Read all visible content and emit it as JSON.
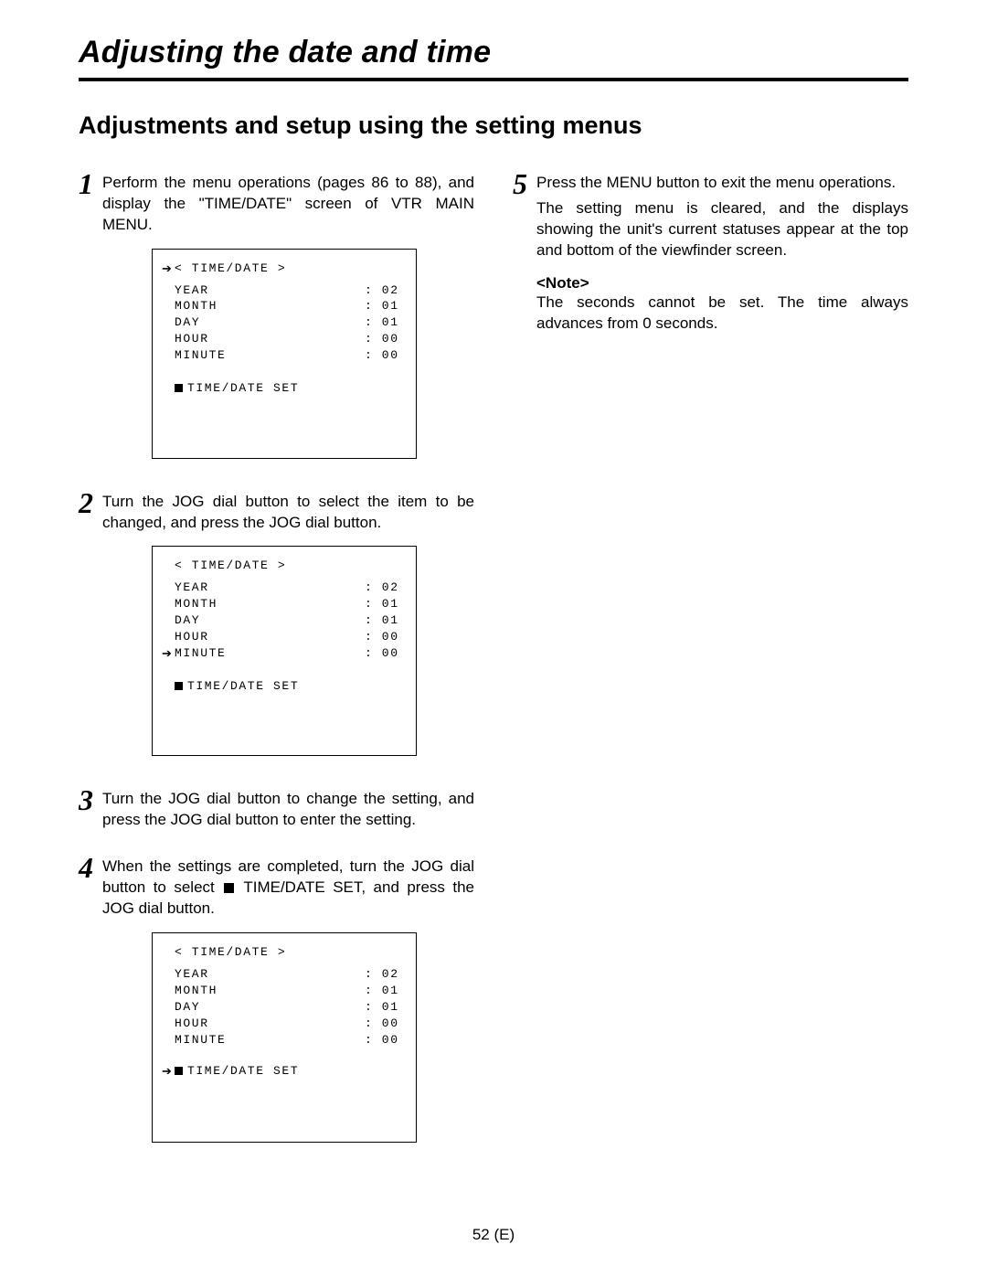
{
  "page": {
    "title": "Adjusting the date and time",
    "subtitle": "Adjustments and setup using the setting menus",
    "footer": "52 (E)"
  },
  "steps": {
    "s1": {
      "num": "1",
      "text": "Perform the menu operations (pages 86 to 88), and display the \"TIME/DATE\" screen of VTR MAIN MENU."
    },
    "s2": {
      "num": "2",
      "text": "Turn the JOG dial button to select the item to be changed, and press the JOG dial button."
    },
    "s3": {
      "num": "3",
      "text": "Turn the JOG dial button to change the setting, and press the JOG dial button to enter the setting."
    },
    "s4": {
      "num": "4",
      "text_a": "When the settings are completed, turn the JOG dial button to select ",
      "text_b": " TIME/DATE SET, and press the JOG dial button."
    },
    "s5": {
      "num": "5",
      "text_a": "Press the MENU button to exit the menu operations.",
      "text_b": "The setting menu is cleared, and the displays showing the unit's current statuses appear at the top and bottom of the viewfinder screen."
    }
  },
  "note": {
    "label": "<Note>",
    "text": "The seconds cannot be set.   The time always advances from 0 seconds."
  },
  "screens": {
    "header": "<  TIME/DATE  >",
    "rows": [
      {
        "label": "YEAR",
        "val": ": 02"
      },
      {
        "label": "MONTH",
        "val": ": 01"
      },
      {
        "label": "DAY",
        "val": ": 01"
      },
      {
        "label": "HOUR",
        "val": ": 00"
      },
      {
        "label": "MINUTE",
        "val": ": 00"
      }
    ],
    "setrow": "TIME/DATE  SET"
  }
}
